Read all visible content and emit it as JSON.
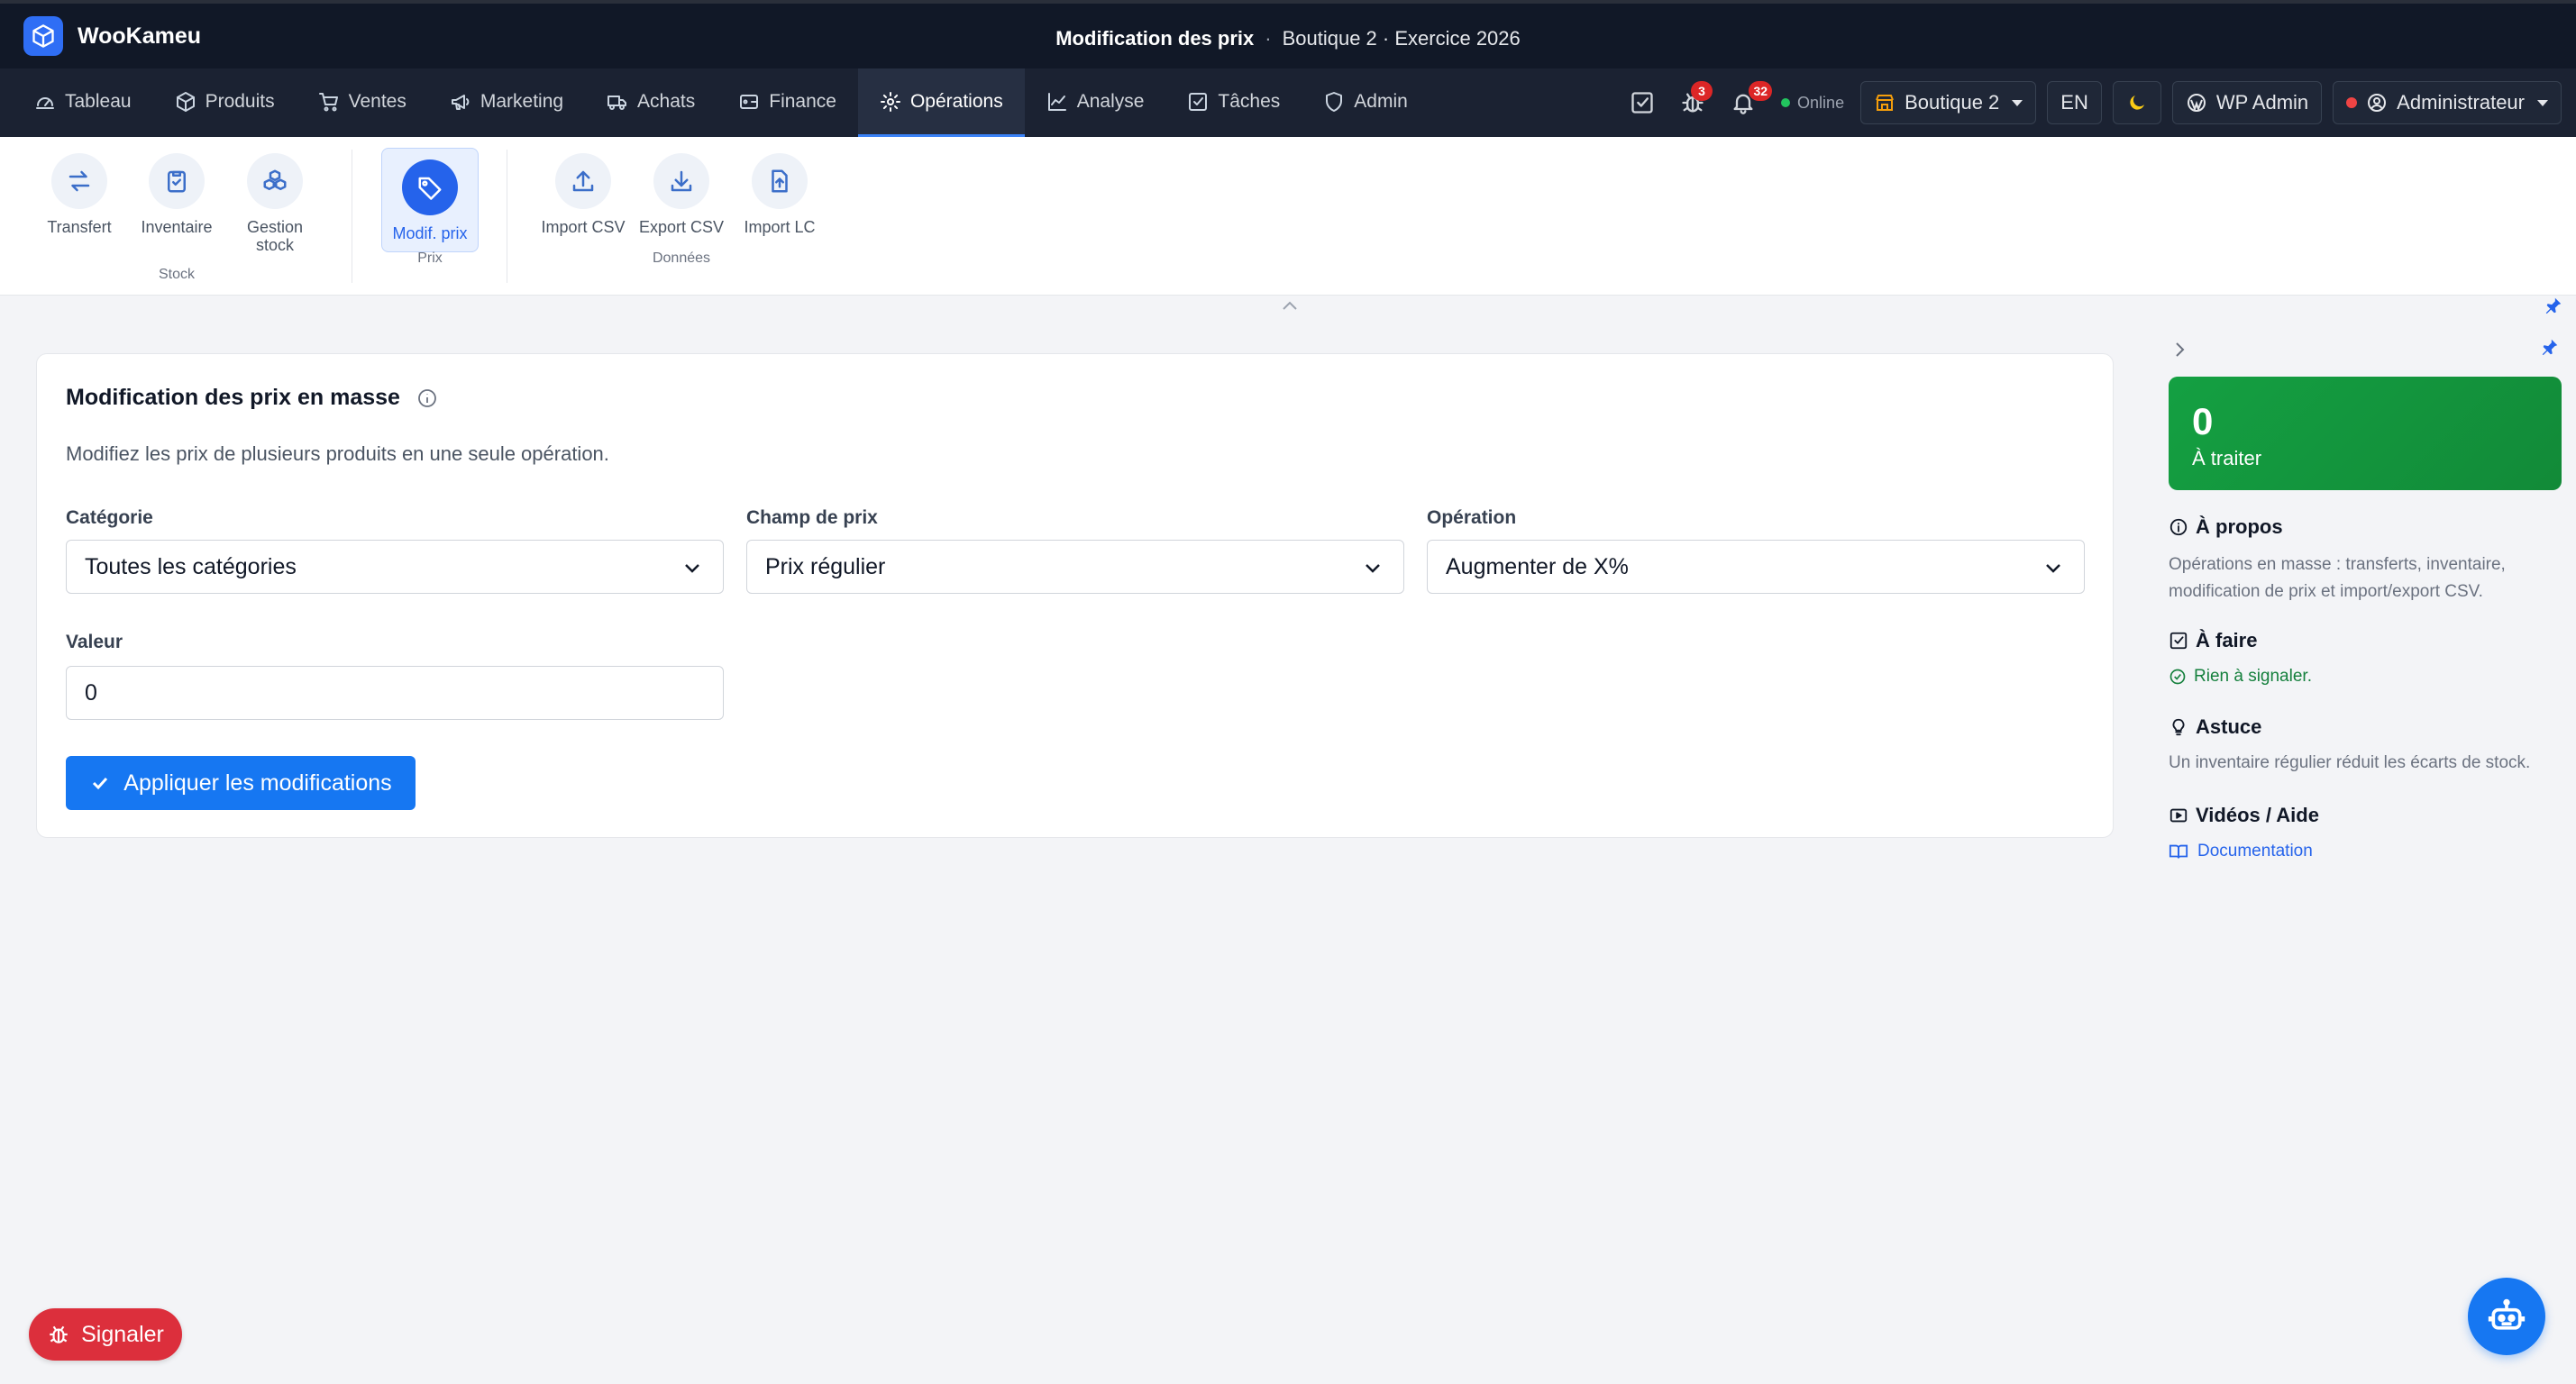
{
  "app": {
    "name": "WooKameu",
    "page_title": "Modification des prix",
    "separator": "·",
    "context": "Boutique 2 · Exercice 2026"
  },
  "nav": {
    "items": [
      {
        "label": "Tableau",
        "icon": "dashboard-icon"
      },
      {
        "label": "Produits",
        "icon": "box-icon"
      },
      {
        "label": "Ventes",
        "icon": "cart-icon"
      },
      {
        "label": "Marketing",
        "icon": "megaphone-icon"
      },
      {
        "label": "Achats",
        "icon": "truck-icon"
      },
      {
        "label": "Finance",
        "icon": "wallet-icon"
      },
      {
        "label": "Opérations",
        "icon": "gear-icon"
      },
      {
        "label": "Analyse",
        "icon": "chart-line-icon"
      },
      {
        "label": "Tâches",
        "icon": "checkbox-icon"
      },
      {
        "label": "Admin",
        "icon": "shield-icon"
      }
    ],
    "active": "Opérations",
    "right": {
      "bug_badge": "3",
      "notif_badge": "32",
      "status": "Online",
      "store": "Boutique 2",
      "lang": "EN",
      "wp_admin": "WP Admin",
      "user": "Administrateur"
    }
  },
  "ribbon": {
    "items": [
      {
        "label": "Transfert",
        "icon": "swap-icon"
      },
      {
        "label": "Inventaire",
        "icon": "clipboard-icon"
      },
      {
        "label": "Gestion stock",
        "icon": "boxes-icon"
      },
      {
        "label": "Modif. prix",
        "icon": "tag-icon"
      },
      {
        "label": "Import CSV",
        "icon": "upload-icon"
      },
      {
        "label": "Export CSV",
        "icon": "download-icon"
      },
      {
        "label": "Import LC",
        "icon": "file-upload-icon"
      }
    ],
    "groups": {
      "stock": "Stock",
      "prix": "Prix",
      "donnees": "Données"
    }
  },
  "form": {
    "title": "Modification des prix en masse",
    "subtitle": "Modifiez les prix de plusieurs produits en une seule opération.",
    "category_label": "Catégorie",
    "category_value": "Toutes les catégories",
    "price_field_label": "Champ de prix",
    "price_field_value": "Prix régulier",
    "operation_label": "Opération",
    "operation_value": "Augmenter de X%",
    "value_label": "Valeur",
    "value_value": "0",
    "apply_label": "Appliquer les modifications"
  },
  "side_panel": {
    "kpi_value": "0",
    "kpi_label": "À traiter",
    "about_title": "À propos",
    "about_text": "Opérations en masse : transferts, inventaire, modification de prix et import/export CSV.",
    "todo_title": "À faire",
    "todo_text": "Rien à signaler.",
    "tip_title": "Astuce",
    "tip_text": "Un inventaire régulier réduit les écarts de stock.",
    "videos_title": "Vidéos / Aide",
    "doc_link": "Documentation"
  },
  "floating": {
    "report_label": "Signaler"
  },
  "colors": {
    "topbar": "#111827",
    "navbar": "#1b2232",
    "accent": "#1677f2",
    "kpi_green": "#14a042",
    "danger": "#dc2f3c"
  }
}
